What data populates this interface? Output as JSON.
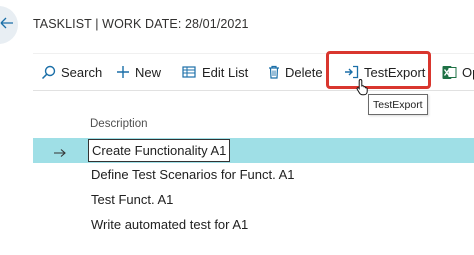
{
  "page": {
    "title": "TASKLIST | WORK DATE: 28/01/2021"
  },
  "actions": [
    {
      "label": "Search",
      "icon": "search-icon"
    },
    {
      "label": "New",
      "icon": "plus-icon"
    },
    {
      "label": "Edit List",
      "icon": "edit-list-icon"
    },
    {
      "label": "Delete",
      "icon": "trash-icon"
    },
    {
      "label": "TestExport",
      "icon": "export-icon"
    },
    {
      "label": "Op",
      "icon": "excel-icon"
    }
  ],
  "tooltip": "TestExport",
  "table": {
    "column": "Description",
    "rows": [
      "Create Functionality A1",
      "Define Test Scenarios for Funct. A1",
      "Test Funct. A1",
      "Write automated test for A1"
    ],
    "selected_row": 0
  },
  "colors": {
    "accent": "#1b6fa8",
    "highlight": "#d9362e",
    "selected_row": "#9fdfe6",
    "excel": "#1e7145"
  }
}
